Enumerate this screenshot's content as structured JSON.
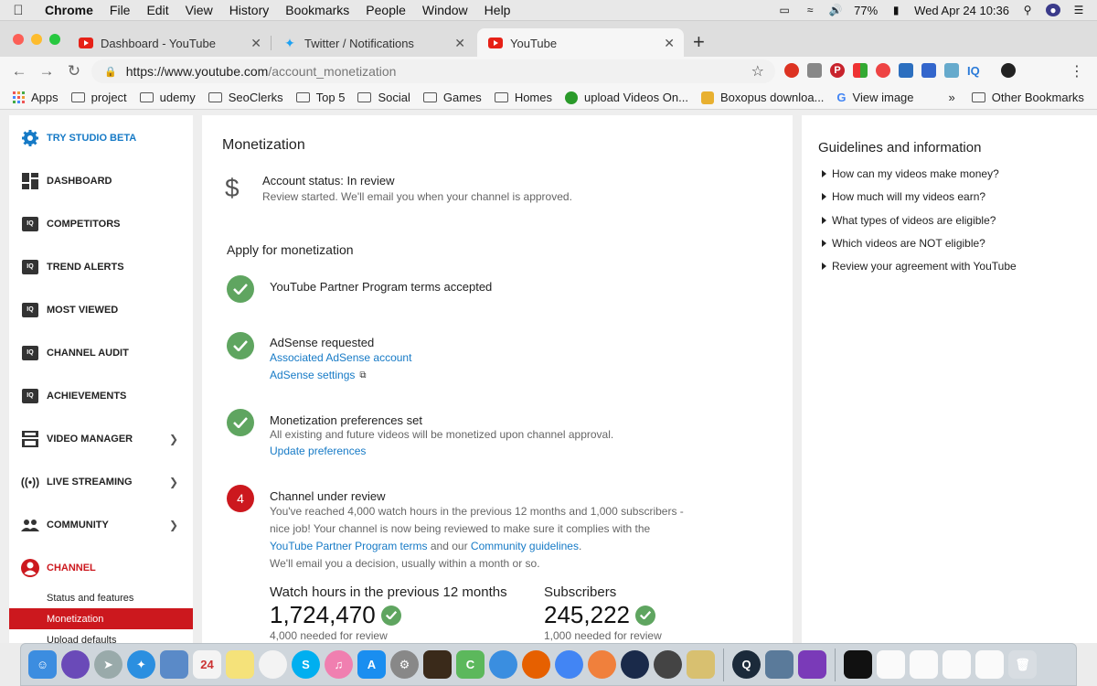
{
  "menubar": {
    "app": "Chrome",
    "items": [
      "File",
      "Edit",
      "View",
      "History",
      "Bookmarks",
      "People",
      "Window",
      "Help"
    ],
    "battery": "77%",
    "datetime": "Wed Apr 24  10:36"
  },
  "tabs": [
    {
      "label": "Dashboard - YouTube",
      "icon": "youtube-icon"
    },
    {
      "label": "Twitter / Notifications",
      "icon": "twitter-icon"
    },
    {
      "label": "YouTube",
      "icon": "youtube-icon",
      "active": true
    }
  ],
  "toolbar": {
    "url_base": "https://www.youtube.com",
    "url_path": "/account_monetization",
    "ext_iq": "IQ"
  },
  "bookmarks": [
    {
      "label": "Apps",
      "icon": "apps-icon"
    },
    {
      "label": "project",
      "icon": "folder-icon"
    },
    {
      "label": "udemy",
      "icon": "folder-icon"
    },
    {
      "label": "SeoClerks",
      "icon": "folder-icon"
    },
    {
      "label": "Top 5",
      "icon": "folder-icon"
    },
    {
      "label": "Social",
      "icon": "folder-icon"
    },
    {
      "label": "Games",
      "icon": "folder-icon"
    },
    {
      "label": "Homes",
      "icon": "folder-icon"
    },
    {
      "label": "upload Videos On...",
      "icon": "green-circle-icon"
    },
    {
      "label": "Boxopus downloa...",
      "icon": "boxopus-icon"
    },
    {
      "label": "View image",
      "icon": "google-icon"
    }
  ],
  "bookmarks_more": "»",
  "bookmarks_other": "Other Bookmarks",
  "sidebar": {
    "studio_beta": "TRY STUDIO BETA",
    "dashboard": "DASHBOARD",
    "competitors": "COMPETITORS",
    "trend_alerts": "TREND ALERTS",
    "most_viewed": "MOST VIEWED",
    "channel_audit": "CHANNEL AUDIT",
    "achievements": "ACHIEVEMENTS",
    "video_manager": "VIDEO MANAGER",
    "live_streaming": "LIVE STREAMING",
    "community": "COMMUNITY",
    "channel": "CHANNEL",
    "sub_status": "Status and features",
    "sub_monetization": "Monetization",
    "sub_upload": "Upload defaults",
    "iq_badge": "IQ"
  },
  "main": {
    "title": "Monetization",
    "dollar": "$",
    "account_status": "Account status: In review",
    "account_sub": "Review started. We'll email you when your channel is approved.",
    "apply_title": "Apply for monetization",
    "step1_title": "YouTube Partner Program terms accepted",
    "step2_title": "AdSense requested",
    "step2_link1": "Associated AdSense account",
    "step2_link2": "AdSense settings",
    "step3_title": "Monetization preferences set",
    "step3_text": "All existing and future videos will be monetized upon channel approval.",
    "step3_link": "Update preferences",
    "step4_num": "4",
    "step4_title": "Channel under review",
    "step4_text1": "You've reached 4,000 watch hours in the previous 12 months and 1,000 subscribers - nice job! Your channel is now being reviewed to make sure it complies with the ",
    "step4_link1": "YouTube Partner Program terms",
    "step4_text2": " and our ",
    "step4_link2": "Community guidelines",
    "step4_text3": ".",
    "step4_text4": "We'll email you a decision, usually within a month or so.",
    "watch_label": "Watch hours in the previous 12 months",
    "watch_value": "1,724,470",
    "watch_need": "4,000 needed for review",
    "subs_label": "Subscribers",
    "subs_value": "245,222",
    "subs_need": "1,000 needed for review"
  },
  "right_panel": {
    "title": "Guidelines and information",
    "items": [
      "How can my videos make money?",
      "How much will my videos earn?",
      "What types of videos are eligible?",
      "Which videos are NOT eligible?",
      "Review your agreement with YouTube"
    ]
  },
  "colors": {
    "youtube_red": "#cc181e",
    "link_blue": "#167ac6",
    "check_green": "#5fa560"
  }
}
